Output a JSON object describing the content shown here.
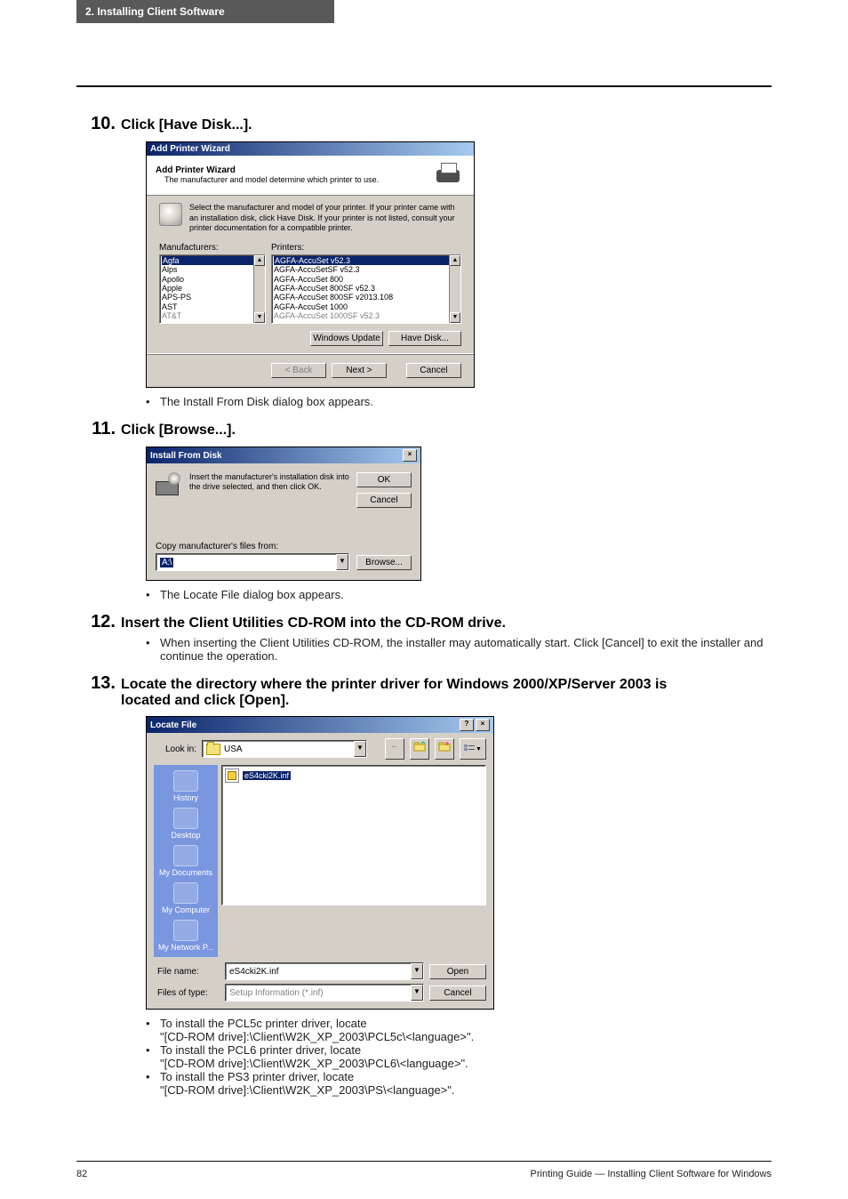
{
  "header_band": "2. Installing Client Software",
  "steps": {
    "s10": {
      "num": "10.",
      "title": "Click [Have Disk...]."
    },
    "s11": {
      "num": "11.",
      "title": "Click [Browse...]."
    },
    "s12": {
      "num": "12.",
      "title": "Insert the Client Utilities CD-ROM into the CD-ROM drive."
    },
    "s13": {
      "num": "13.",
      "title": "Locate the directory where the printer driver for Windows 2000/XP/Server 2003 is located and click [Open]."
    }
  },
  "notes": {
    "after10": "The Install From Disk dialog box appears.",
    "after11": "The Locate File dialog box appears.",
    "after12": "When inserting the Client Utilities CD-ROM, the installer may automatically start. Click [Cancel] to exit the installer and continue the operation.",
    "after13": {
      "l1": "To install the PCL5c printer driver, locate",
      "l1b": "\"[CD-ROM drive]:\\Client\\W2K_XP_2003\\PCL5c\\<language>\".",
      "l2": "To install the PCL6 printer driver, locate",
      "l2b": "\"[CD-ROM drive]:\\Client\\W2K_XP_2003\\PCL6\\<language>\".",
      "l3": "To install the PS3 printer driver, locate",
      "l3b": "\"[CD-ROM drive]:\\Client\\W2K_XP_2003\\PS\\<language>\"."
    }
  },
  "wizard": {
    "window_title": "Add Printer Wizard",
    "header_title": "Add Printer Wizard",
    "header_sub": "The manufacturer and model determine which printer to use.",
    "info_text": "Select the manufacturer and model of your printer. If your printer came with an installation disk, click Have Disk. If your printer is not listed, consult your printer documentation for a compatible printer.",
    "manuf_label": "Manufacturers:",
    "printers_label": "Printers:",
    "manufacturers": [
      "Agfa",
      "Alps",
      "Apollo",
      "Apple",
      "APS-PS",
      "AST",
      "AT&T"
    ],
    "printers": [
      "AGFA-AccuSet v52.3",
      "AGFA-AccuSetSF v52.3",
      "AGFA-AccuSet 800",
      "AGFA-AccuSet 800SF v52.3",
      "AGFA-AccuSet 800SF v2013.108",
      "AGFA-AccuSet 1000",
      "AGFA-AccuSet 1000SF v52.3"
    ],
    "btn_windows_update": "Windows Update",
    "btn_have_disk": "Have Disk...",
    "btn_back": "< Back",
    "btn_next": "Next >",
    "btn_cancel": "Cancel"
  },
  "ifd": {
    "title": "Install From Disk",
    "msg": "Insert the manufacturer's installation disk into the drive selected, and then click OK.",
    "btn_ok": "OK",
    "btn_cancel": "Cancel",
    "copy_label": "Copy manufacturer's files from:",
    "combo_value": "A:\\",
    "btn_browse": "Browse..."
  },
  "loc": {
    "title": "Locate File",
    "lookin_label": "Look in:",
    "lookin_value": "USA",
    "back_arrow": "←",
    "sidebar": {
      "history": "History",
      "desktop": "Desktop",
      "mydocs": "My Documents",
      "mycomp": "My Computer",
      "mynet": "My Network P..."
    },
    "file_item": "eS4cki2K.inf",
    "filename_label": "File name:",
    "filename_value": "eS4cki2K.inf",
    "filetype_label": "Files of type:",
    "filetype_value": "Setup Information (*.inf)",
    "btn_open": "Open",
    "btn_cancel": "Cancel"
  },
  "footer": {
    "page": "82",
    "right": "Printing Guide — Installing Client Software for Windows"
  }
}
